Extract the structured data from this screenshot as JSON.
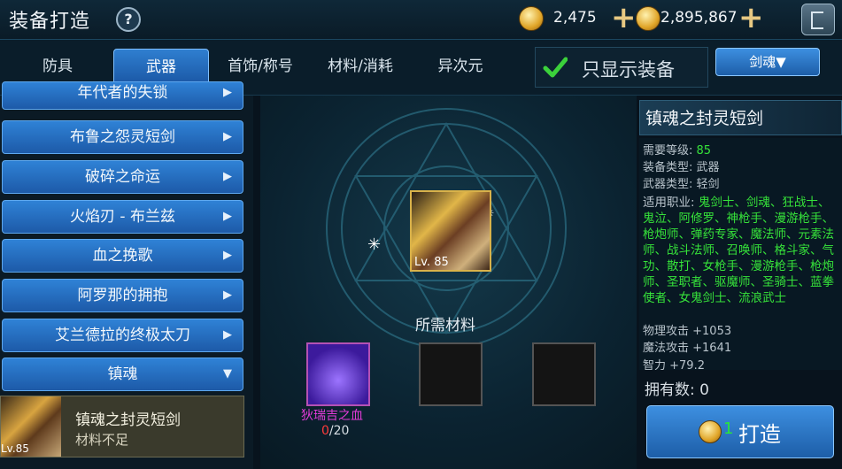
{
  "header": {
    "title": "装备打造",
    "help": "?",
    "gold": "2,475",
    "coins": "2,895,867"
  },
  "tabs": [
    {
      "label": "防具"
    },
    {
      "label": "武器"
    },
    {
      "label": "首饰/称号"
    },
    {
      "label": "材料/消耗"
    },
    {
      "label": "异次元"
    }
  ],
  "filter": {
    "show_only_equipment": "只显示装备",
    "class_dropdown": "剑魂▼"
  },
  "left_list": {
    "items": [
      {
        "label": "年代者的失锁"
      },
      {
        "label": "布鲁之怨灵短剑"
      },
      {
        "label": "破碎之命运"
      },
      {
        "label": "火焰刃 - 布兰兹"
      },
      {
        "label": "血之挽歌"
      },
      {
        "label": "阿罗那的拥抱"
      },
      {
        "label": "艾兰德拉的终极太刀"
      },
      {
        "label": "镇魂"
      }
    ],
    "selected": {
      "name": "镇魂之封灵短剑",
      "status": "材料不足",
      "level": "Lv.85"
    }
  },
  "center": {
    "weapon_level": "Lv. 85",
    "required_label": "所需材料",
    "material": {
      "name": "狄瑞吉之血",
      "have": "0",
      "need": "/20"
    }
  },
  "detail": {
    "title": "镇魂之封灵短剑",
    "req_level_label": "需要等级:",
    "req_level": "85",
    "equip_type": "装备类型:  武器",
    "weapon_type": "武器类型:  轻剑",
    "jobs_label": "适用职业:",
    "jobs": "鬼剑士、剑魂、狂战士、鬼泣、阿修罗、神枪手、漫游枪手、枪炮师、弹药专家、魔法师、元素法师、战斗法师、召唤师、格斗家、气功、散打、女枪手、漫游枪手、枪炮师、圣职者、驱魔师、圣骑士、蓝拳使者、女鬼剑士、流浪武士",
    "phys_atk": "物理攻击 +1053",
    "mag_atk": "魔法攻击 +1641",
    "int": "智力 +79.2",
    "owned": "拥有数:  0",
    "craft_cost": "1",
    "craft_label": "打造"
  },
  "colors": {
    "accent": "#2f82d6",
    "green": "#36e23a",
    "danger": "#ff3b3b"
  }
}
